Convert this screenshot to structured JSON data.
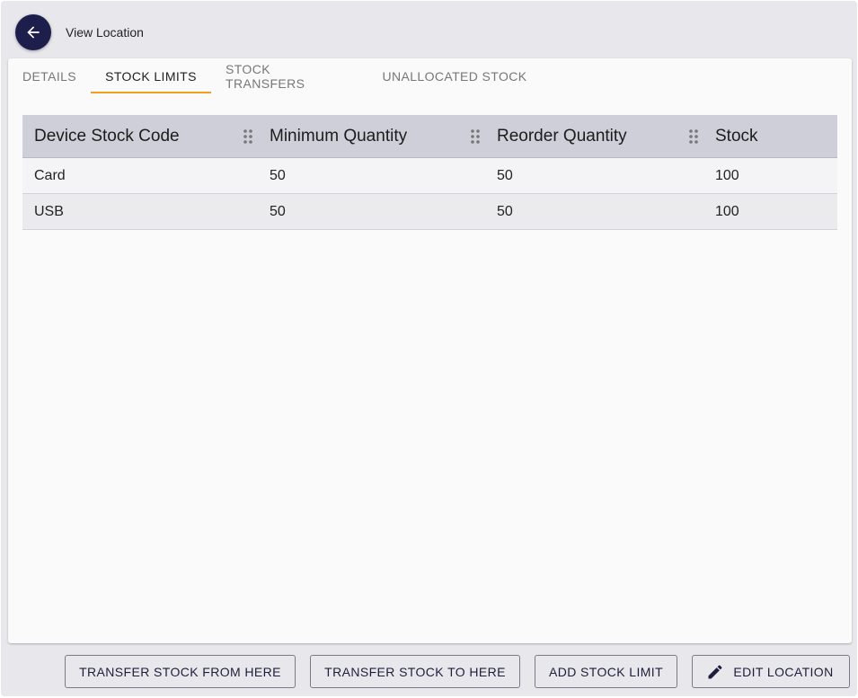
{
  "header": {
    "back_icon": "arrow-left-icon",
    "title": "View Location",
    "accent_color": "#1e1e4c"
  },
  "tabs": [
    {
      "label": "DETAILS",
      "active": false
    },
    {
      "label": "STOCK LIMITS",
      "active": true
    },
    {
      "label": "STOCK TRANSFERS",
      "active": false
    },
    {
      "label": "UNALLOCATED STOCK",
      "active": false
    }
  ],
  "tab_indicator_color": "#f0a020",
  "table": {
    "columns": [
      "Device Stock Code",
      "Minimum Quantity",
      "Reorder Quantity",
      "Stock"
    ],
    "rows": [
      [
        "Card",
        "50",
        "50",
        "100"
      ],
      [
        "USB",
        "50",
        "50",
        "100"
      ]
    ]
  },
  "actions": {
    "transfer_from": "TRANSFER STOCK FROM HERE",
    "transfer_to": "TRANSFER STOCK TO HERE",
    "add_limit": "ADD STOCK LIMIT",
    "edit_location": "EDIT LOCATION",
    "edit_icon": "pencil-icon"
  }
}
